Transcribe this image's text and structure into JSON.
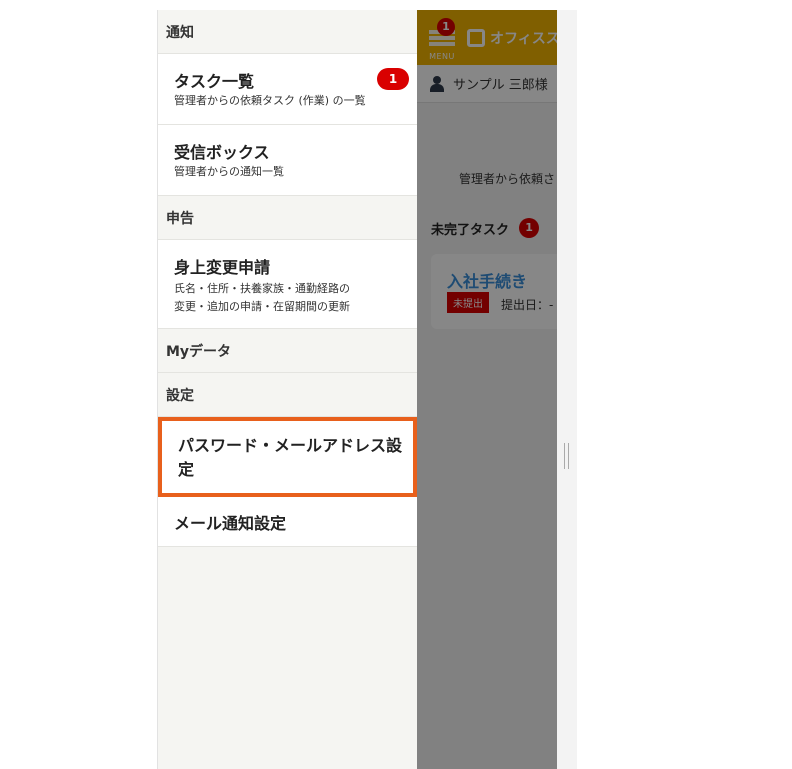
{
  "background": {
    "menu_label": "MENU",
    "menu_badge": "1",
    "brand_name": "オフィスス",
    "user_name": "サンプル 三郎様",
    "description": "管理者から依頼さ",
    "section_title": "未完了タスク",
    "section_badge": "1",
    "card": {
      "title": "入社手続き",
      "status": "未提出",
      "date_label": "提出日：-"
    }
  },
  "drawer": {
    "sections": {
      "notifications": "通知",
      "applications": "申告",
      "mydata": "Myデータ",
      "settings": "設定"
    },
    "items": {
      "tasks": {
        "title": "タスク一覧",
        "subtitle": "管理者からの依頼タスク (作業) の一覧",
        "badge": "1"
      },
      "inbox": {
        "title": "受信ボックス",
        "subtitle": "管理者からの通知一覧"
      },
      "change": {
        "title": "身上変更申請",
        "subtitle_line1": "氏名・住所・扶養家族・通勤経路の",
        "subtitle_line2": "変更・追加の申請・在留期間の更新"
      },
      "password": {
        "title": "パスワード・メールアドレス設定"
      },
      "mail": {
        "title": "メール通知設定"
      }
    }
  },
  "colors": {
    "header": "#f2b400",
    "badge": "#d90000",
    "highlight": "#e8601c",
    "link": "#3a8fd9"
  }
}
